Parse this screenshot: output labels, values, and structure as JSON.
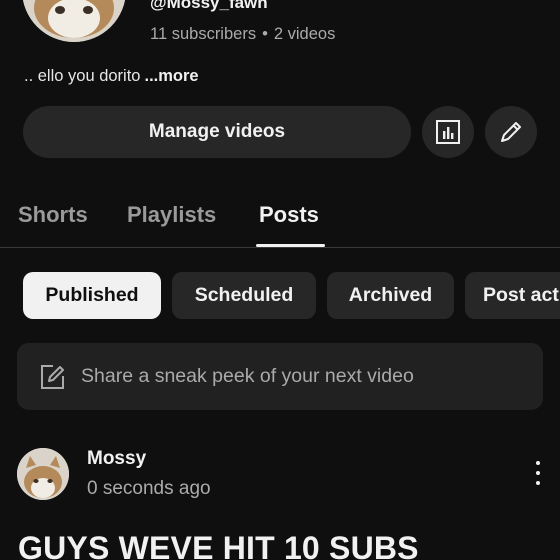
{
  "channel": {
    "handle": "@Mossy_fawn",
    "subscribers": "11 subscribers",
    "separator": "•",
    "videos": "2 videos",
    "bio": ".. ello you dorito",
    "more_label": "...more"
  },
  "actions": {
    "manage_videos_label": "Manage videos",
    "analytics_icon": "bar-chart-icon",
    "edit_icon": "pencil-icon"
  },
  "tabs": [
    {
      "label": "Shorts",
      "active": false
    },
    {
      "label": "Playlists",
      "active": false
    },
    {
      "label": "Posts",
      "active": true
    }
  ],
  "filters": [
    {
      "label": "Published",
      "active": true
    },
    {
      "label": "Scheduled",
      "active": false
    },
    {
      "label": "Archived",
      "active": false
    },
    {
      "label": "Post act",
      "active": false
    }
  ],
  "composer": {
    "icon": "edit-square-icon",
    "placeholder": "Share a sneak peek of your next video"
  },
  "post": {
    "author": "Mossy",
    "time": "0 seconds ago",
    "text": "GUYS WEVE HIT 10 SUBS"
  },
  "colors": {
    "background": "#0f0f0f",
    "surface": "#272727",
    "active_chip": "#f1f1f1"
  }
}
